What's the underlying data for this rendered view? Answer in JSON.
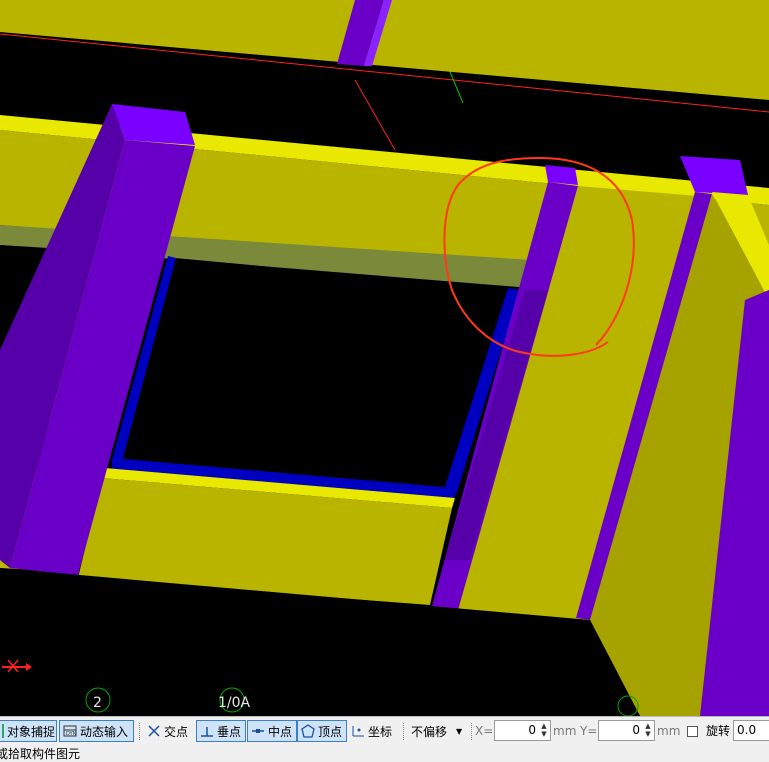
{
  "viewport": {
    "axis_labels": [
      "2",
      "1/0A"
    ],
    "colors": {
      "background": "#000000",
      "beam_yellow": "#b8b400",
      "beam_top": "#e8e800",
      "column_purple": "#6a00c8",
      "opening_frame": "#0000c0",
      "grid_line": "#ff2020",
      "annotation": "#ff3a1a",
      "axis_green": "#00cc00"
    }
  },
  "toolbar": {
    "object_snap": "对象捕捉",
    "dynamic_input": "动态输入",
    "intersection": "交点",
    "perpendicular": "垂点",
    "midpoint": "中点",
    "vertex": "顶点",
    "coordinate": "坐标",
    "offset_select": "不偏移",
    "x_label": "X=",
    "x_value": "0",
    "x_unit": "mm",
    "y_label": "Y=",
    "y_value": "0",
    "y_unit": "mm",
    "rotate_label": "旋转",
    "rotate_value": "0.0"
  },
  "status": {
    "text": "或拾取构件图元"
  }
}
